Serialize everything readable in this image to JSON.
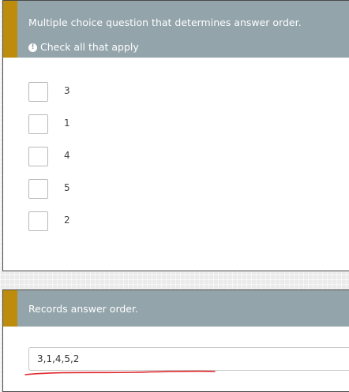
{
  "question1": {
    "title": "Multiple choice question that determines answer order.",
    "hint": "Check all that apply",
    "options": [
      {
        "label": "3",
        "checked": false
      },
      {
        "label": "1",
        "checked": false
      },
      {
        "label": "4",
        "checked": false
      },
      {
        "label": "5",
        "checked": false
      },
      {
        "label": "2",
        "checked": false
      }
    ]
  },
  "question2": {
    "title": "Records answer order.",
    "answer_value": "3,1,4,5,2"
  },
  "colors": {
    "header_bg": "#93a4ab",
    "accent_bar": "#bd8c0c",
    "annotation_line": "#e0292f"
  },
  "icons": {
    "hint_icon": "info-circle-icon"
  }
}
